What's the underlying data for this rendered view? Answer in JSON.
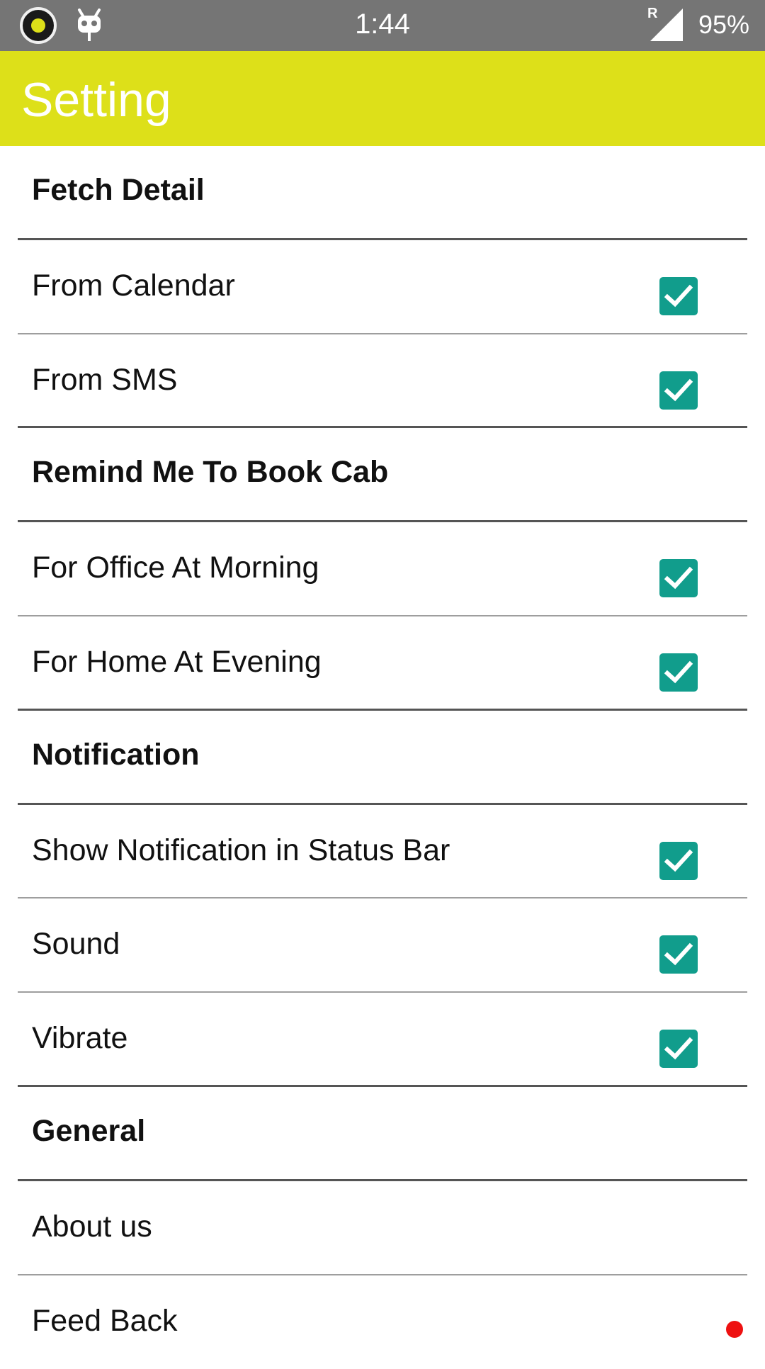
{
  "status_bar": {
    "time": "1:44",
    "network_tag": "R",
    "battery": "95%",
    "icons": [
      "app-notification-icon",
      "android-debug-icon",
      "signal-icon"
    ]
  },
  "app_bar": {
    "title": "Setting",
    "color": "#dde019"
  },
  "settings": [
    {
      "type": "header",
      "label": "Fetch Detail"
    },
    {
      "type": "checkbox",
      "label": "From Calendar",
      "checked": true
    },
    {
      "type": "checkbox",
      "label": "From SMS",
      "checked": true
    },
    {
      "type": "header",
      "label": "Remind Me To Book Cab"
    },
    {
      "type": "checkbox",
      "label": "For Office At Morning",
      "checked": true
    },
    {
      "type": "checkbox",
      "label": "For Home At Evening",
      "checked": true
    },
    {
      "type": "header",
      "label": "Notification"
    },
    {
      "type": "checkbox",
      "label": "Show Notification in Status Bar",
      "checked": true
    },
    {
      "type": "checkbox",
      "label": "Sound",
      "checked": true
    },
    {
      "type": "checkbox",
      "label": "Vibrate",
      "checked": true
    },
    {
      "type": "header",
      "label": "General"
    },
    {
      "type": "item",
      "label": "About us"
    },
    {
      "type": "item",
      "label": "Feed Back"
    }
  ],
  "colors": {
    "checkbox": "#119d8c",
    "status_bar": "#757575",
    "dot": "#ee1111"
  }
}
